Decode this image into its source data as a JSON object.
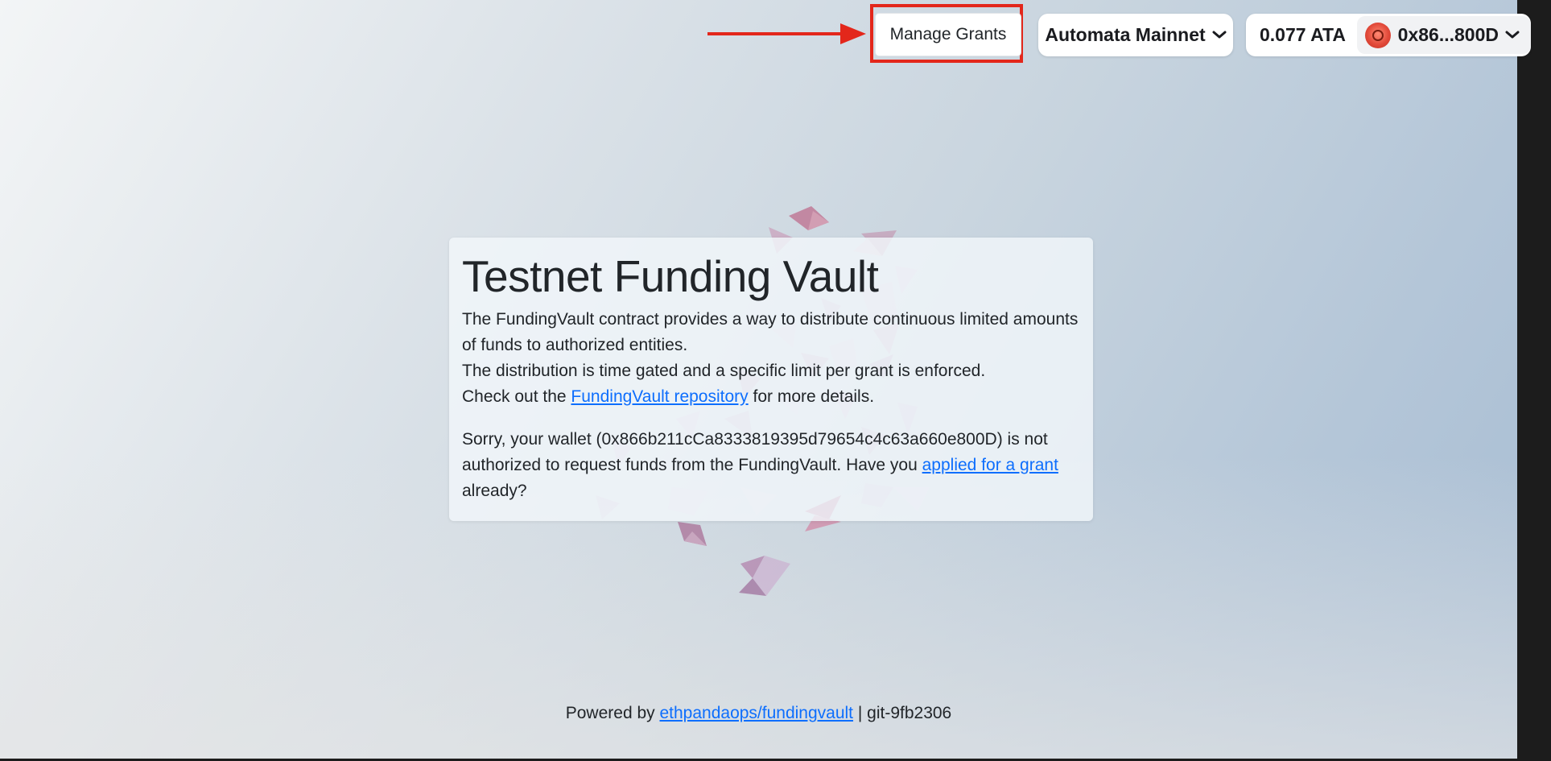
{
  "header": {
    "manage_grants_label": "Manage Grants",
    "network_label": "Automata Mainnet",
    "wallet_balance": "0.077 ATA",
    "wallet_address_short": "0x86...800D",
    "chevron": "❯"
  },
  "card": {
    "title": "Testnet Funding Vault",
    "intro_line1": "The FundingVault contract provides a way to distribute continuous limited amounts of funds to authorized entities.",
    "intro_line2": "The distribution is time gated and a specific limit per grant is enforced.",
    "intro_line3_prefix": "Check out the ",
    "repo_link_label": "FundingVault repository",
    "intro_line3_suffix": " for more details.",
    "notice_prefix": "Sorry, your wallet (0x866b211cCa8333819395d79654c4c63a660e800D) is not authorized to request funds from the FundingVault. Have you ",
    "apply_link_label": "applied for a grant",
    "notice_suffix": " already?"
  },
  "footer": {
    "prefix": "Powered by ",
    "repo_link_label": "ethpandaops/fundingvault",
    "separator": " | ",
    "version": "git-9fb2306"
  },
  "annotation": {
    "highlight_color": "#e3271b"
  },
  "icons": {
    "network_chevron": "chevron-down-icon",
    "wallet_chevron": "chevron-down-icon",
    "avatar": "wallet-avatar-icon"
  }
}
